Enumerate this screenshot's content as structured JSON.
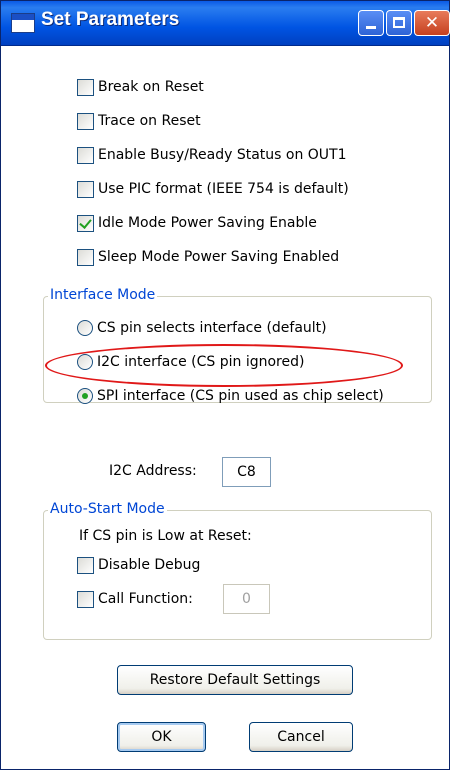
{
  "window": {
    "title": "Set Parameters",
    "close_glyph": "✕"
  },
  "options": {
    "break_on_reset": {
      "label": "Break on Reset",
      "checked": false
    },
    "trace_on_reset": {
      "label": "Trace on Reset",
      "checked": false
    },
    "busy_ready": {
      "label": "Enable Busy/Ready Status on OUT1",
      "checked": false
    },
    "pic_format": {
      "label": "Use PIC format (IEEE 754 is default)",
      "checked": false
    },
    "idle_mode": {
      "label": "Idle Mode Power Saving Enable",
      "checked": true
    },
    "sleep_mode": {
      "label": "Sleep Mode Power Saving Enabled",
      "checked": false
    }
  },
  "interface_mode": {
    "legend": "Interface Mode",
    "options": [
      {
        "label": "CS pin selects interface (default)",
        "selected": false
      },
      {
        "label": "I2C interface (CS pin ignored)",
        "selected": false
      },
      {
        "label": "SPI interface (CS pin used as chip select)",
        "selected": true
      }
    ]
  },
  "i2c_address": {
    "label": "I2C Address:",
    "value": "C8"
  },
  "auto_start": {
    "legend": "Auto-Start Mode",
    "condition": "If CS pin is Low at Reset:",
    "disable_debug": {
      "label": "Disable Debug",
      "checked": false
    },
    "call_function": {
      "label": "Call Function:",
      "checked": false,
      "value": "0"
    }
  },
  "buttons": {
    "restore": "Restore Default Settings",
    "ok": "OK",
    "cancel": "Cancel"
  },
  "colors": {
    "titlebar": "#0054e3",
    "legend_text": "#0046d5",
    "highlight": "#e01818",
    "check": "#21a121"
  }
}
